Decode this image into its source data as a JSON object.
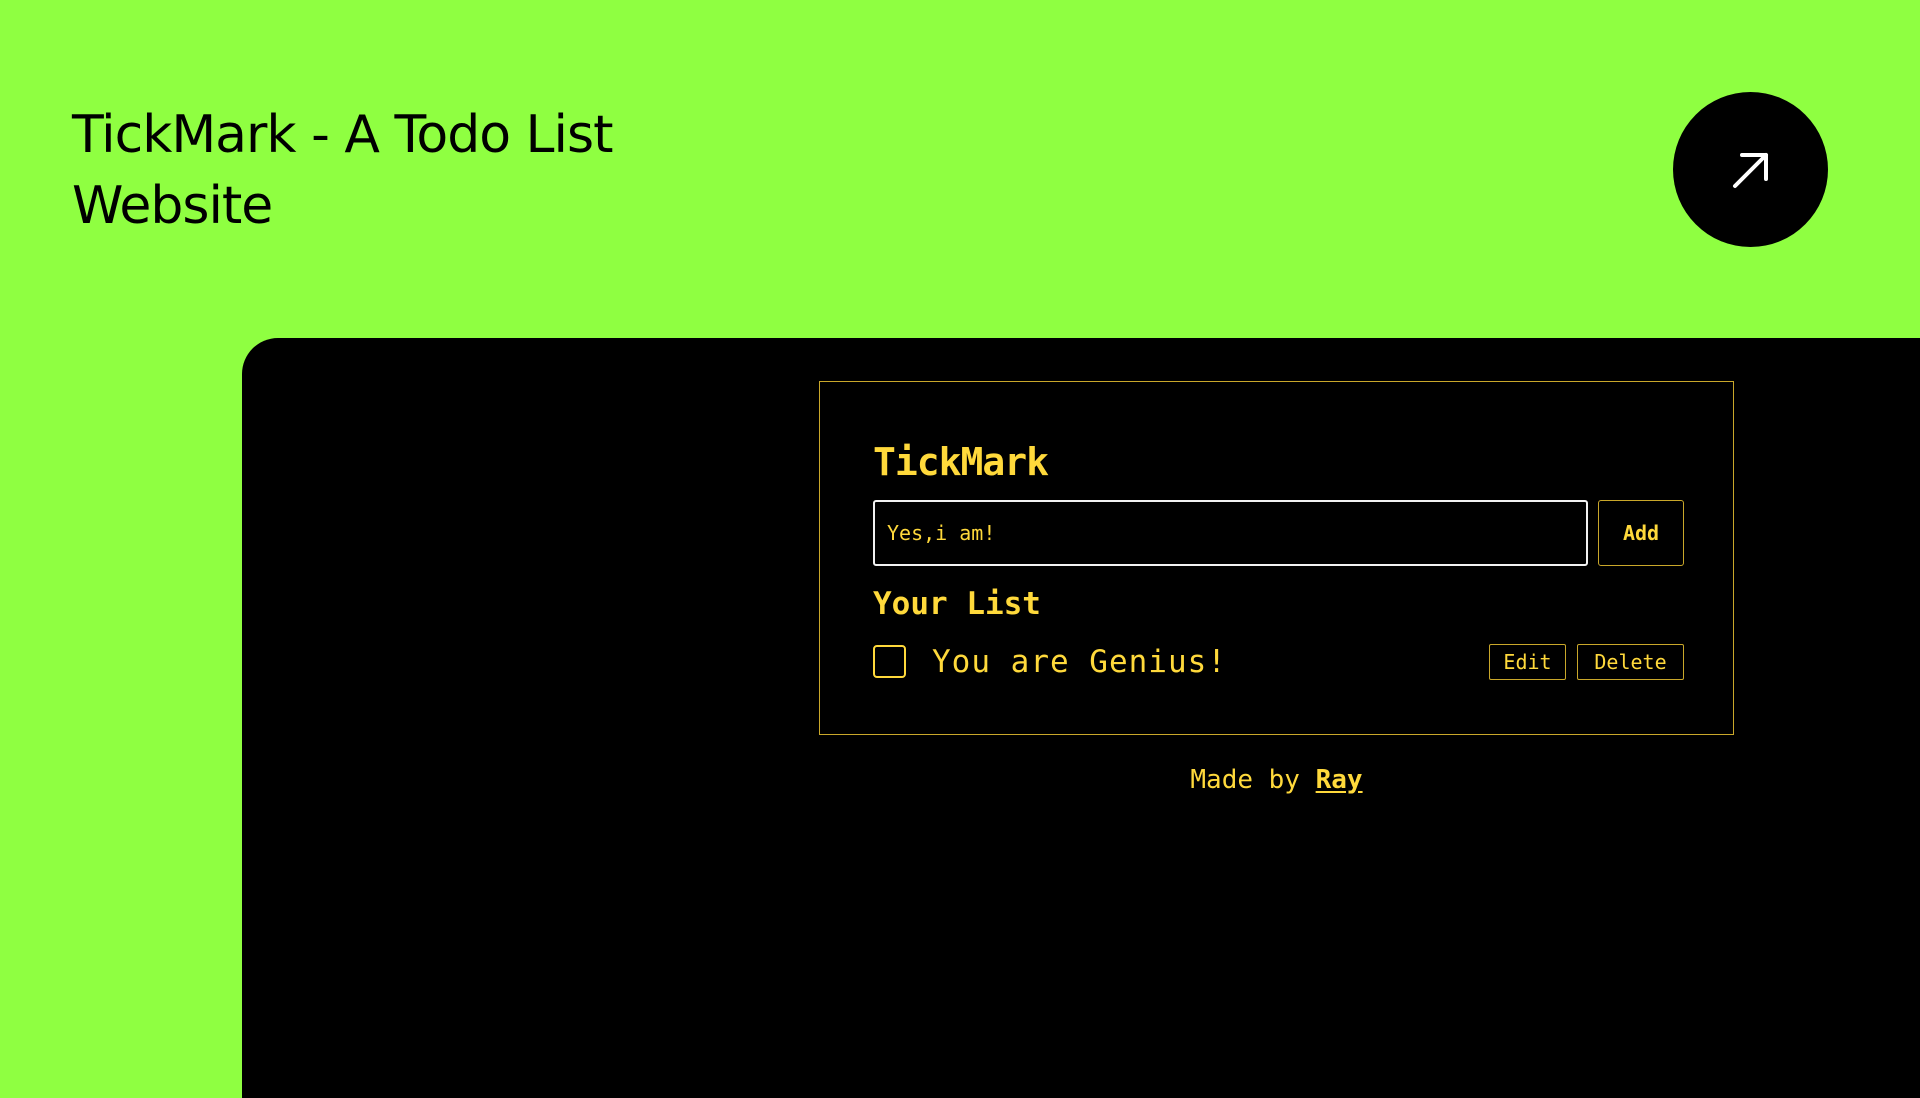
{
  "headline": {
    "line1": "TickMark - A Todo List",
    "line2": "Website"
  },
  "open_link": {
    "icon": "arrow-up-right-icon"
  },
  "app": {
    "title": "TickMark",
    "input_value": "Yes,i am!",
    "add_label": "Add",
    "list_heading": "Your List",
    "todos": [
      {
        "text": "You are Genius!",
        "checked": false,
        "edit_label": "Edit",
        "delete_label": "Delete"
      }
    ],
    "footer": {
      "prefix": "Made by",
      "author": "Ray"
    }
  },
  "colors": {
    "page_background": "#8fff41",
    "app_background": "#000000",
    "accent_yellow": "#ffd93b",
    "border_gold": "#c9a72a"
  }
}
